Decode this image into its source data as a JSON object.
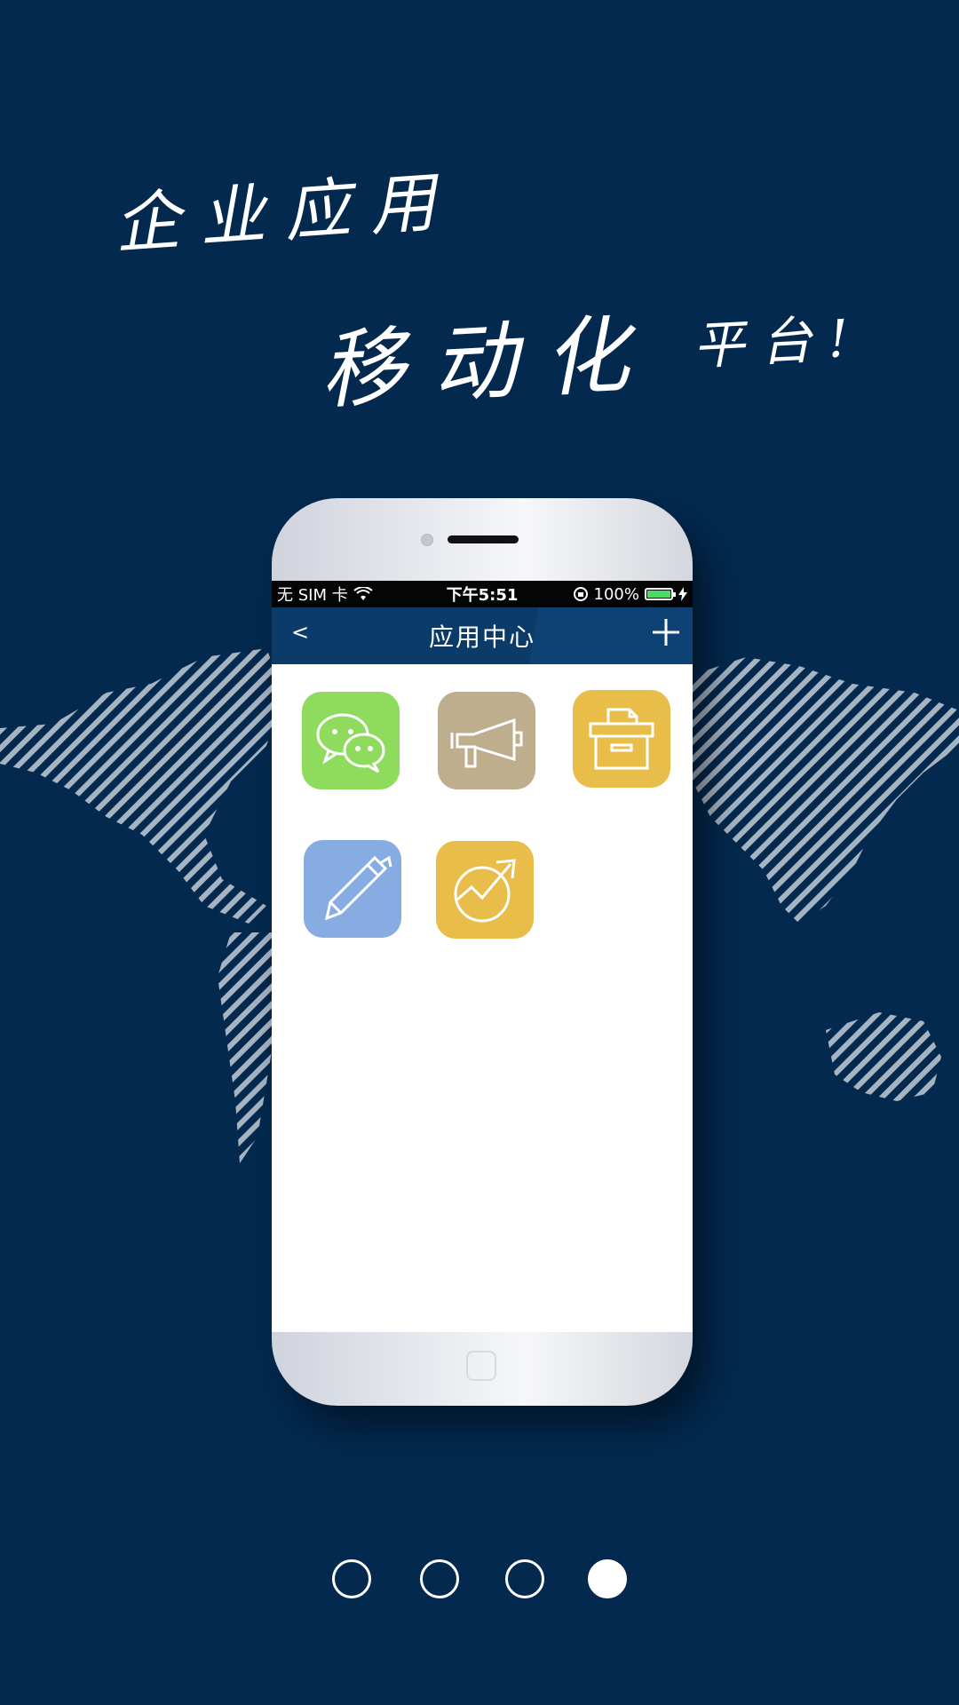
{
  "slogan": {
    "line1": "企业应用",
    "line2": "移动化",
    "line3": "平台!"
  },
  "statusbar": {
    "carrier": "无 SIM 卡",
    "time": "下午5:51",
    "battery": "100%",
    "battery_level": 1.0
  },
  "navbar": {
    "back": "<",
    "title": "应用中心"
  },
  "apps": [
    {
      "icon": "wechat-icon",
      "color": "#8fdb5d"
    },
    {
      "icon": "megaphone-icon",
      "color": "#bfae8d"
    },
    {
      "icon": "archive-box-icon",
      "color": "#e8bd4a"
    },
    {
      "icon": "pen-icon",
      "color": "#87ace2"
    },
    {
      "icon": "growth-chart-icon",
      "color": "#e8bd4a"
    }
  ],
  "pagination": {
    "count": 4,
    "active_index": 4
  },
  "colors": {
    "background": "#03294f",
    "navbar": "#0b3b69"
  }
}
